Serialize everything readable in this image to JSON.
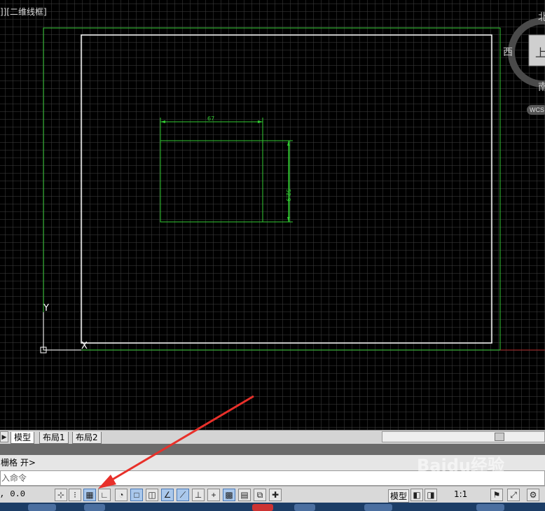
{
  "viewport": {
    "label": "]][二维线框]"
  },
  "viewcube": {
    "north": "北",
    "west": "西",
    "south": "南",
    "top_face": "上",
    "wcs": "WCS"
  },
  "ucs_icon": {
    "y_label": "Y",
    "x_label": "X"
  },
  "drawing": {
    "dim_width": "67",
    "dim_height": "52.9"
  },
  "tabs": [
    {
      "label": "模型",
      "active": true
    },
    {
      "label": "布局1",
      "active": false
    },
    {
      "label": "布局2",
      "active": false
    }
  ],
  "command": {
    "history": "栅格 开>",
    "input_placeholder": "入命令"
  },
  "statusbar": {
    "coords": ", 0.0",
    "model_label": "模型",
    "scale_label": "1:1"
  },
  "watermark": "Baidu经验",
  "colors": {
    "canvas_bg": "#000000",
    "layout_border": "#33cc33",
    "paper_border": "#ffffff",
    "dimension": "#33ff33",
    "annotation_arrow": "#e8302a"
  }
}
